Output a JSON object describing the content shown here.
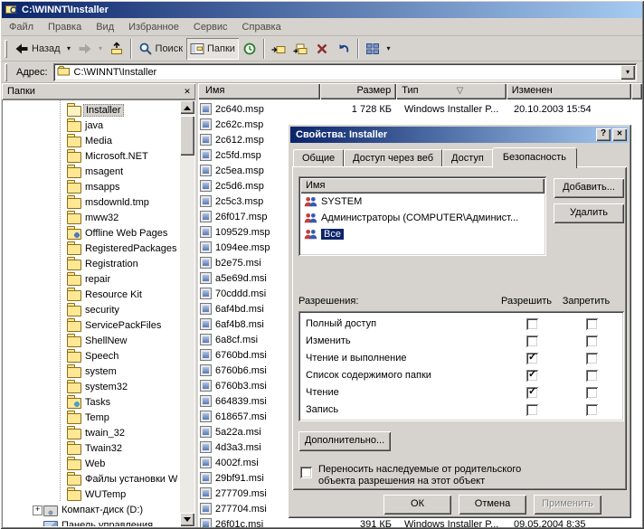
{
  "glyphs": {
    "dropdown": "▾",
    "sort": "▽",
    "help": "?",
    "close": "✕"
  },
  "colors": {
    "titlebar_start": "#0a246a",
    "titlebar_end": "#a6caf0",
    "selection": "#0a246a",
    "window_bg": "#d6d3ce"
  },
  "window": {
    "title": "C:\\WINNT\\Installer"
  },
  "menu_bar": {
    "items": [
      "Файл",
      "Правка",
      "Вид",
      "Избранное",
      "Сервис",
      "Справка"
    ]
  },
  "toolbar": {
    "back_label": "Назад",
    "search_label": "Поиск",
    "folders_label": "Папки",
    "icons": [
      "back",
      "forward",
      "folder-up",
      "search",
      "folders-pane",
      "history",
      "move-to",
      "copy-to",
      "delete",
      "undo",
      "views"
    ]
  },
  "address_bar": {
    "label": "Адрес:",
    "value": "C:\\WINNT\\Installer"
  },
  "folders_panel": {
    "title": "Папки",
    "items": [
      {
        "label": "Installer",
        "icon": "folder-open",
        "level": 4,
        "selected": true
      },
      {
        "label": "java",
        "icon": "folder",
        "level": 4
      },
      {
        "label": "Media",
        "icon": "folder",
        "level": 4
      },
      {
        "label": "Microsoft.NET",
        "icon": "folder",
        "level": 4
      },
      {
        "label": "msagent",
        "icon": "folder",
        "level": 4
      },
      {
        "label": "msapps",
        "icon": "folder",
        "level": 4
      },
      {
        "label": "msdownld.tmp",
        "icon": "folder",
        "level": 4
      },
      {
        "label": "mww32",
        "icon": "folder",
        "level": 4
      },
      {
        "label": "Offline Web Pages",
        "icon": "folder-web",
        "level": 4
      },
      {
        "label": "RegisteredPackages",
        "icon": "folder",
        "level": 4
      },
      {
        "label": "Registration",
        "icon": "folder",
        "level": 4
      },
      {
        "label": "repair",
        "icon": "folder",
        "level": 4
      },
      {
        "label": "Resource Kit",
        "icon": "folder",
        "level": 4
      },
      {
        "label": "security",
        "icon": "folder",
        "level": 4
      },
      {
        "label": "ServicePackFiles",
        "icon": "folder",
        "level": 4
      },
      {
        "label": "ShellNew",
        "icon": "folder",
        "level": 4
      },
      {
        "label": "Speech",
        "icon": "folder",
        "level": 4
      },
      {
        "label": "system",
        "icon": "folder",
        "level": 4
      },
      {
        "label": "system32",
        "icon": "folder",
        "level": 4
      },
      {
        "label": "Tasks",
        "icon": "tasks",
        "level": 4
      },
      {
        "label": "Temp",
        "icon": "folder",
        "level": 4
      },
      {
        "label": "twain_32",
        "icon": "folder",
        "level": 4
      },
      {
        "label": "Twain32",
        "icon": "folder",
        "level": 4
      },
      {
        "label": "Web",
        "icon": "folder",
        "level": 4
      },
      {
        "label": "Файлы установки W",
        "icon": "folder",
        "level": 4
      },
      {
        "label": "WUTemp",
        "icon": "folder",
        "level": 4
      },
      {
        "label": "Компакт-диск (D:)",
        "icon": "cd-drive",
        "level": 2,
        "expander": "plus"
      },
      {
        "label": "Панель управления",
        "icon": "control-panel",
        "level": 2
      }
    ]
  },
  "file_list": {
    "columns": [
      {
        "label": "Имя"
      },
      {
        "label": "Размер"
      },
      {
        "label": "Тип"
      },
      {
        "label": "Изменен"
      }
    ],
    "rows": [
      {
        "name": "2c640.msp",
        "size": "1 728 КБ",
        "type": "Windows Installer P...",
        "modified": "20.10.2003 15:54"
      },
      {
        "name": "2c62c.msp"
      },
      {
        "name": "2c612.msp"
      },
      {
        "name": "2c5fd.msp"
      },
      {
        "name": "2c5ea.msp"
      },
      {
        "name": "2c5d6.msp"
      },
      {
        "name": "2c5c3.msp"
      },
      {
        "name": "26f017.msp"
      },
      {
        "name": "109529.msp"
      },
      {
        "name": "1094ee.msp"
      },
      {
        "name": "b2e75.msi"
      },
      {
        "name": "a5e69d.msi"
      },
      {
        "name": "70cddd.msi"
      },
      {
        "name": "6af4bd.msi"
      },
      {
        "name": "6af4b8.msi"
      },
      {
        "name": "6a8cf.msi"
      },
      {
        "name": "6760bd.msi"
      },
      {
        "name": "6760b6.msi"
      },
      {
        "name": "6760b3.msi"
      },
      {
        "name": "664839.msi"
      },
      {
        "name": "618657.msi"
      },
      {
        "name": "5a22a.msi"
      },
      {
        "name": "4d3a3.msi"
      },
      {
        "name": "4002f.msi"
      },
      {
        "name": "29bf91.msi"
      },
      {
        "name": "277709.msi"
      },
      {
        "name": "277704.msi"
      },
      {
        "name": "26f01c.msi",
        "size": "391 КБ",
        "type": "Windows Installer P...",
        "modified": "09.05.2004 8:35"
      }
    ]
  },
  "dialog": {
    "title": "Свойства: Installer",
    "tabs": [
      {
        "label": "Общие"
      },
      {
        "label": "Доступ через веб"
      },
      {
        "label": "Доступ"
      },
      {
        "label": "Безопасность",
        "active": true
      }
    ],
    "names_header": "Имя",
    "names": [
      {
        "label": "SYSTEM",
        "icon": "user-group"
      },
      {
        "label": "Администраторы (COMPUTER\\Админист...",
        "icon": "user-group"
      },
      {
        "label": "Все",
        "icon": "user-group",
        "selected": true
      }
    ],
    "add_button": "Добавить...",
    "remove_button": "Удалить",
    "permissions_label": "Разрешения:",
    "allow_header": "Разрешить",
    "deny_header": "Запретить",
    "permissions": [
      {
        "label": "Полный доступ",
        "allow": false,
        "deny": false
      },
      {
        "label": "Изменить",
        "allow": false,
        "deny": false
      },
      {
        "label": "Чтение и выполнение",
        "allow": true,
        "deny": false
      },
      {
        "label": "Список содержимого папки",
        "allow": true,
        "deny": false
      },
      {
        "label": "Чтение",
        "allow": true,
        "deny": false
      },
      {
        "label": "Запись",
        "allow": false,
        "deny": false
      }
    ],
    "advanced_button": "Дополнительно...",
    "inherit_label": "Переносить наследуемые от родительского объекта разрешения на этот объект",
    "inherit_checked": false,
    "ok_button": "ОК",
    "cancel_button": "Отмена",
    "apply_button": "Применить"
  }
}
